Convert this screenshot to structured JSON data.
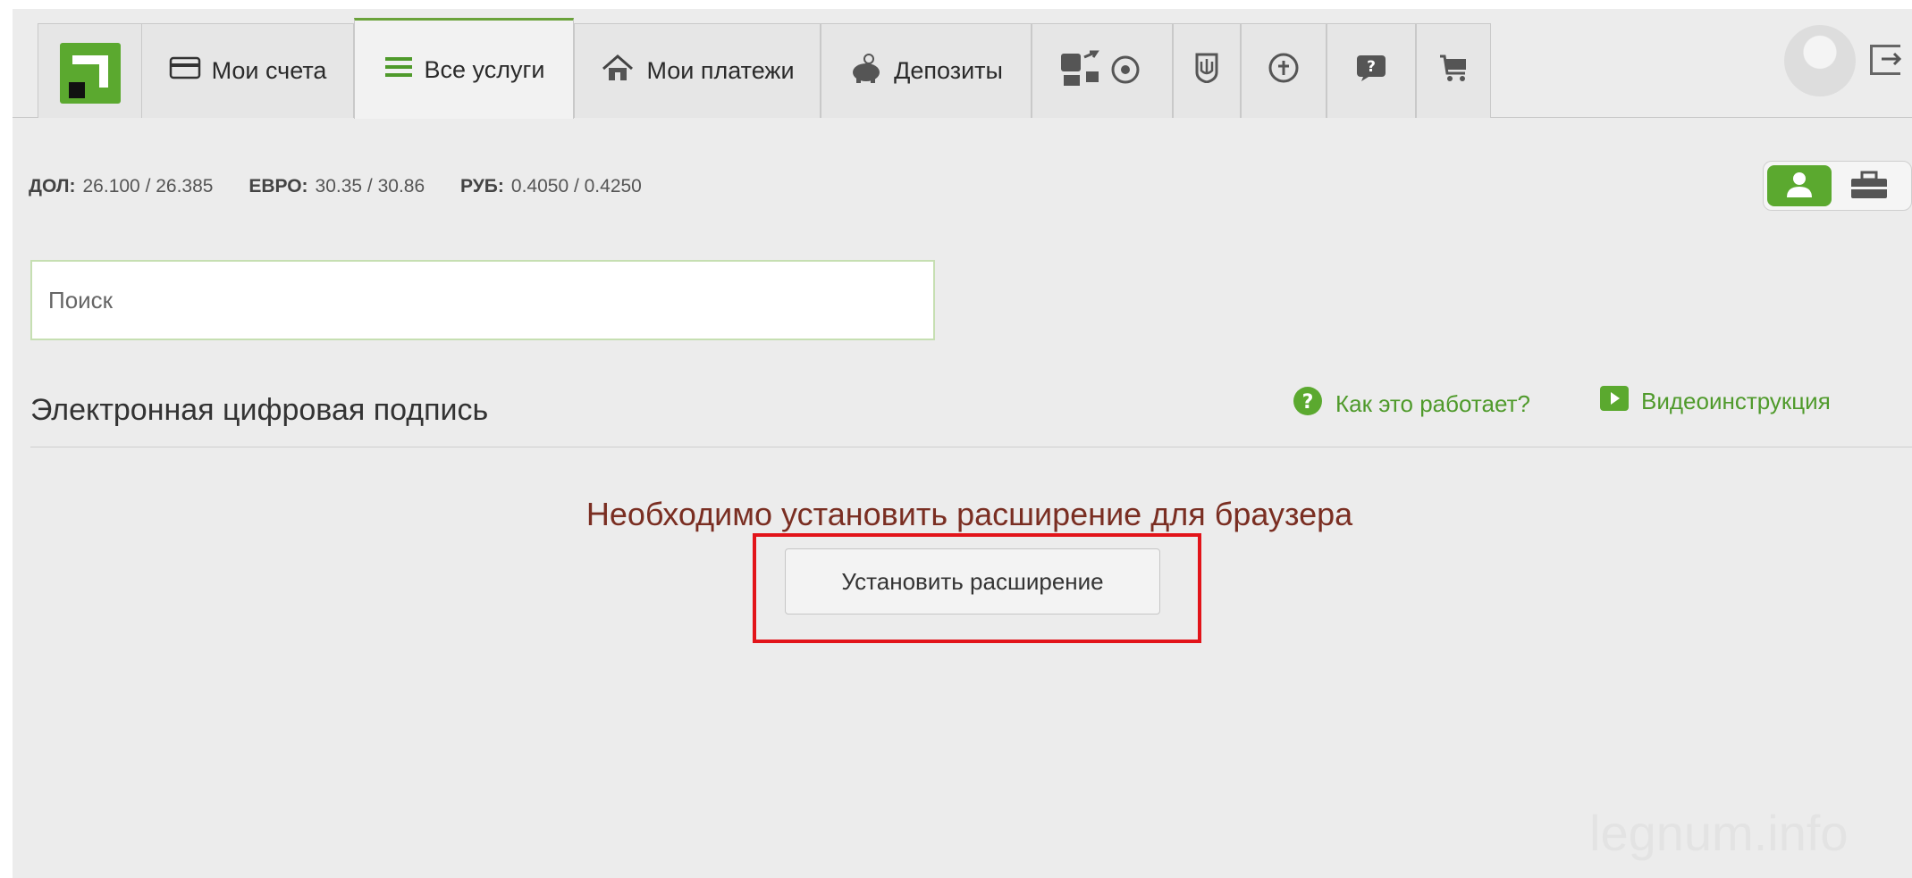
{
  "nav": {
    "tabs": [
      {
        "id": "accounts",
        "label": "Мои счета",
        "icon": "card-icon"
      },
      {
        "id": "services",
        "label": "Все услуги",
        "icon": "list-icon",
        "active": true
      },
      {
        "id": "payments",
        "label": "Мои платежи",
        "icon": "house-icon"
      },
      {
        "id": "deposits",
        "label": "Депозиты",
        "icon": "piggy-bank-icon"
      }
    ],
    "icon_tabs": [
      "transport-ball-icon",
      "coat-of-arms-icon",
      "refresh-icon",
      "help-icon",
      "cart-icon"
    ]
  },
  "rates": [
    {
      "label": "ДОЛ:",
      "value": "26.100 / 26.385"
    },
    {
      "label": "ЕВРО:",
      "value": "30.35 / 30.86"
    },
    {
      "label": "РУБ:",
      "value": "0.4050 / 0.4250"
    }
  ],
  "search": {
    "placeholder": "Поиск"
  },
  "section": {
    "title": "Электронная цифровая подпись",
    "help_link": "Как это работает?",
    "video_link": "Видеоинструкция"
  },
  "message": "Необходимо установить расширение для браузера",
  "install_button": "Установить расширение",
  "watermark": "legnum.info",
  "colors": {
    "accent": "#5ba92f",
    "link": "#4f9a2b",
    "warning": "#7a2e22",
    "highlight": "#e2141a"
  }
}
